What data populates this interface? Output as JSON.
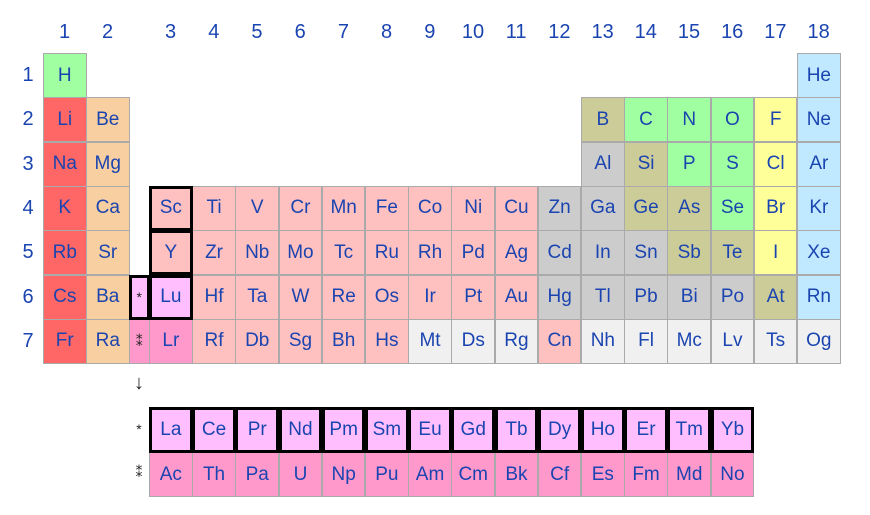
{
  "groups": [
    "1",
    "2",
    "3",
    "4",
    "5",
    "6",
    "7",
    "8",
    "9",
    "10",
    "11",
    "12",
    "13",
    "14",
    "15",
    "16",
    "17",
    "18"
  ],
  "periods": [
    "1",
    "2",
    "3",
    "4",
    "5",
    "6",
    "7"
  ],
  "colors": {
    "alkali": "#ff6666",
    "alkaline": "#f8cfa0",
    "transition": "#ffc0c0",
    "lanthanide": "#ffbfff",
    "actinide": "#ff99cc",
    "post": "#cccccc",
    "metalloid": "#cccc99",
    "nonmetal": "#a0ffa0",
    "halogen": "#ffff99",
    "noble": "#c0e8ff",
    "unknown": "#f0f0f0",
    "text": "#1a44b0"
  },
  "markers": {
    "lanthanide_star": "*",
    "actinide_star": "⁑",
    "arrow": "↓"
  },
  "elements": [
    [
      "H",
      1,
      1,
      "nonmetal"
    ],
    [
      "He",
      1,
      18,
      "noble"
    ],
    [
      "Li",
      2,
      1,
      "alkali"
    ],
    [
      "Be",
      2,
      2,
      "alkaline"
    ],
    [
      "B",
      2,
      13,
      "metalloid"
    ],
    [
      "C",
      2,
      14,
      "nonmetal"
    ],
    [
      "N",
      2,
      15,
      "nonmetal"
    ],
    [
      "O",
      2,
      16,
      "nonmetal"
    ],
    [
      "F",
      2,
      17,
      "halogen"
    ],
    [
      "Ne",
      2,
      18,
      "noble"
    ],
    [
      "Na",
      3,
      1,
      "alkali"
    ],
    [
      "Mg",
      3,
      2,
      "alkaline"
    ],
    [
      "Al",
      3,
      13,
      "post"
    ],
    [
      "Si",
      3,
      14,
      "metalloid"
    ],
    [
      "P",
      3,
      15,
      "nonmetal"
    ],
    [
      "S",
      3,
      16,
      "nonmetal"
    ],
    [
      "Cl",
      3,
      17,
      "halogen"
    ],
    [
      "Ar",
      3,
      18,
      "noble"
    ],
    [
      "K",
      4,
      1,
      "alkali"
    ],
    [
      "Ca",
      4,
      2,
      "alkaline"
    ],
    [
      "Sc",
      4,
      3,
      "transition"
    ],
    [
      "Ti",
      4,
      4,
      "transition"
    ],
    [
      "V",
      4,
      5,
      "transition"
    ],
    [
      "Cr",
      4,
      6,
      "transition"
    ],
    [
      "Mn",
      4,
      7,
      "transition"
    ],
    [
      "Fe",
      4,
      8,
      "transition"
    ],
    [
      "Co",
      4,
      9,
      "transition"
    ],
    [
      "Ni",
      4,
      10,
      "transition"
    ],
    [
      "Cu",
      4,
      11,
      "transition"
    ],
    [
      "Zn",
      4,
      12,
      "post"
    ],
    [
      "Ga",
      4,
      13,
      "post"
    ],
    [
      "Ge",
      4,
      14,
      "metalloid"
    ],
    [
      "As",
      4,
      15,
      "metalloid"
    ],
    [
      "Se",
      4,
      16,
      "nonmetal"
    ],
    [
      "Br",
      4,
      17,
      "halogen"
    ],
    [
      "Kr",
      4,
      18,
      "noble"
    ],
    [
      "Rb",
      5,
      1,
      "alkali"
    ],
    [
      "Sr",
      5,
      2,
      "alkaline"
    ],
    [
      "Y",
      5,
      3,
      "transition"
    ],
    [
      "Zr",
      5,
      4,
      "transition"
    ],
    [
      "Nb",
      5,
      5,
      "transition"
    ],
    [
      "Mo",
      5,
      6,
      "transition"
    ],
    [
      "Tc",
      5,
      7,
      "transition"
    ],
    [
      "Ru",
      5,
      8,
      "transition"
    ],
    [
      "Rh",
      5,
      9,
      "transition"
    ],
    [
      "Pd",
      5,
      10,
      "transition"
    ],
    [
      "Ag",
      5,
      11,
      "transition"
    ],
    [
      "Cd",
      5,
      12,
      "post"
    ],
    [
      "In",
      5,
      13,
      "post"
    ],
    [
      "Sn",
      5,
      14,
      "post"
    ],
    [
      "Sb",
      5,
      15,
      "metalloid"
    ],
    [
      "Te",
      5,
      16,
      "metalloid"
    ],
    [
      "I",
      5,
      17,
      "halogen"
    ],
    [
      "Xe",
      5,
      18,
      "noble"
    ],
    [
      "Cs",
      6,
      1,
      "alkali"
    ],
    [
      "Ba",
      6,
      2,
      "alkaline"
    ],
    [
      "Lu",
      6,
      3,
      "lanthanide"
    ],
    [
      "Hf",
      6,
      4,
      "transition"
    ],
    [
      "Ta",
      6,
      5,
      "transition"
    ],
    [
      "W",
      6,
      6,
      "transition"
    ],
    [
      "Re",
      6,
      7,
      "transition"
    ],
    [
      "Os",
      6,
      8,
      "transition"
    ],
    [
      "Ir",
      6,
      9,
      "transition"
    ],
    [
      "Pt",
      6,
      10,
      "transition"
    ],
    [
      "Au",
      6,
      11,
      "transition"
    ],
    [
      "Hg",
      6,
      12,
      "post"
    ],
    [
      "Tl",
      6,
      13,
      "post"
    ],
    [
      "Pb",
      6,
      14,
      "post"
    ],
    [
      "Bi",
      6,
      15,
      "post"
    ],
    [
      "Po",
      6,
      16,
      "post"
    ],
    [
      "At",
      6,
      17,
      "metalloid"
    ],
    [
      "Rn",
      6,
      18,
      "noble"
    ],
    [
      "Fr",
      7,
      1,
      "alkali"
    ],
    [
      "Ra",
      7,
      2,
      "alkaline"
    ],
    [
      "Lr",
      7,
      3,
      "actinide"
    ],
    [
      "Rf",
      7,
      4,
      "transition"
    ],
    [
      "Db",
      7,
      5,
      "transition"
    ],
    [
      "Sg",
      7,
      6,
      "transition"
    ],
    [
      "Bh",
      7,
      7,
      "transition"
    ],
    [
      "Hs",
      7,
      8,
      "transition"
    ],
    [
      "Mt",
      7,
      9,
      "unknown"
    ],
    [
      "Ds",
      7,
      10,
      "unknown"
    ],
    [
      "Rg",
      7,
      11,
      "unknown"
    ],
    [
      "Cn",
      7,
      12,
      "transition"
    ],
    [
      "Nh",
      7,
      13,
      "unknown"
    ],
    [
      "Fl",
      7,
      14,
      "unknown"
    ],
    [
      "Mc",
      7,
      15,
      "unknown"
    ],
    [
      "Lv",
      7,
      16,
      "unknown"
    ],
    [
      "Ts",
      7,
      17,
      "unknown"
    ],
    [
      "Og",
      7,
      18,
      "unknown"
    ]
  ],
  "lanthanides": [
    "La",
    "Ce",
    "Pr",
    "Nd",
    "Pm",
    "Sm",
    "Eu",
    "Gd",
    "Tb",
    "Dy",
    "Ho",
    "Er",
    "Tm",
    "Yb"
  ],
  "actinides": [
    "Ac",
    "Th",
    "Pa",
    "U",
    "Np",
    "Pu",
    "Am",
    "Cm",
    "Bk",
    "Cf",
    "Es",
    "Fm",
    "Md",
    "No"
  ],
  "boxed": [
    "Sc",
    "Y",
    "Lu"
  ]
}
